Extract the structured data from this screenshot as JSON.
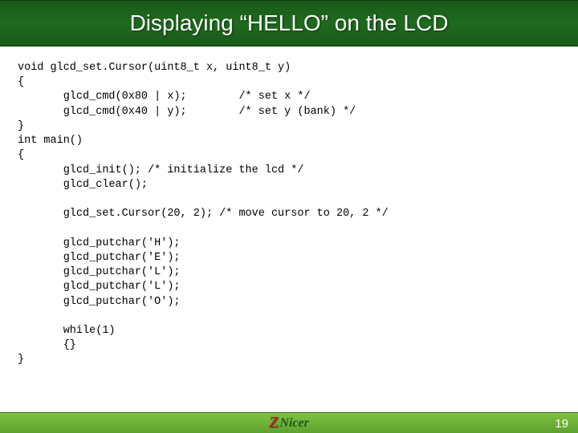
{
  "title": "Displaying “HELLO” on the LCD",
  "code": "void glcd_set.Cursor(uint8_t x, uint8_t y)\n{\n       glcd_cmd(0x80 | x);        /* set x */\n       glcd_cmd(0x40 | y);        /* set y (bank) */\n}\nint main()\n{\n       glcd_init(); /* initialize the lcd */\n       glcd_clear();\n\n       glcd_set.Cursor(20, 2); /* move cursor to 20, 2 */\n\n       glcd_putchar('H');\n       glcd_putchar('E');\n       glcd_putchar('L');\n       glcd_putchar('L');\n       glcd_putchar('O');\n\n       while(1)\n       {}\n}",
  "logo": {
    "z": "Z",
    "nicer": "Nicer"
  },
  "page_number": "19"
}
